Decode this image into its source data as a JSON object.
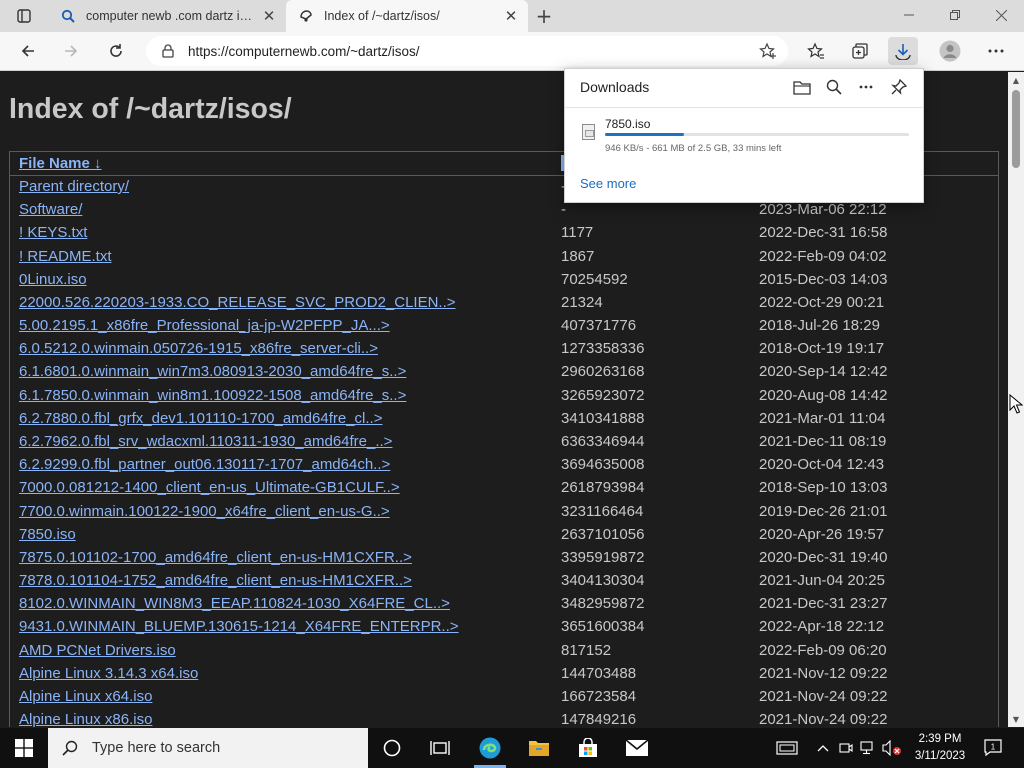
{
  "browser": {
    "tabs": [
      {
        "title": "computer newb .com dartz isos -",
        "active": false
      },
      {
        "title": "Index of /~dartz/isos/",
        "active": true
      }
    ],
    "url": "https://computernewb.com/~dartz/isos/"
  },
  "page": {
    "heading": "Index of /~dartz/isos/",
    "columns": {
      "name": "File Name",
      "sort_indicator": "↓"
    },
    "rows": [
      {
        "name": "Parent directory/",
        "size": "-",
        "date": ""
      },
      {
        "name": "Software/",
        "size": "-",
        "date": "2023-Mar-06 22:12"
      },
      {
        "name": "! KEYS.txt",
        "size": "1177",
        "date": "2022-Dec-31 16:58"
      },
      {
        "name": "! README.txt",
        "size": "1867",
        "date": "2022-Feb-09 04:02"
      },
      {
        "name": "0Linux.iso",
        "size": "70254592",
        "date": "2015-Dec-03 14:03"
      },
      {
        "name": "22000.526.220203-1933.CO_RELEASE_SVC_PROD2_CLIEN..>",
        "size": "21324",
        "date": "2022-Oct-29 00:21"
      },
      {
        "name": "5.00.2195.1_x86fre_Professional_ja-jp-W2PFPP_JA...>",
        "size": "407371776",
        "date": "2018-Jul-26 18:29"
      },
      {
        "name": "6.0.5212.0.winmain.050726-1915_x86fre_server-cli..>",
        "size": "1273358336",
        "date": "2018-Oct-19 19:17"
      },
      {
        "name": "6.1.6801.0.winmain_win7m3.080913-2030_amd64fre_s..>",
        "size": "2960263168",
        "date": "2020-Sep-14 12:42"
      },
      {
        "name": "6.1.7850.0.winmain_win8m1.100922-1508_amd64fre_s..>",
        "size": "3265923072",
        "date": "2020-Aug-08 14:42"
      },
      {
        "name": "6.2.7880.0.fbl_grfx_dev1.101110-1700_amd64fre_cl..>",
        "size": "3410341888",
        "date": "2021-Mar-01 11:04"
      },
      {
        "name": "6.2.7962.0.fbl_srv_wdacxml.110311-1930_amd64fre_..>",
        "size": "6363346944",
        "date": "2021-Dec-11 08:19"
      },
      {
        "name": "6.2.9299.0.fbl_partner_out06.130117-1707_amd64ch..>",
        "size": "3694635008",
        "date": "2020-Oct-04 12:43"
      },
      {
        "name": "7000.0.081212-1400_client_en-us_Ultimate-GB1CULF..>",
        "size": "2618793984",
        "date": "2018-Sep-10 13:03"
      },
      {
        "name": "7700.0.winmain.100122-1900_x64fre_client_en-us-G..>",
        "size": "3231166464",
        "date": "2019-Dec-26 21:01"
      },
      {
        "name": "7850.iso",
        "size": "2637101056",
        "date": "2020-Apr-26 19:57"
      },
      {
        "name": "7875.0.101102-1700_amd64fre_client_en-us-HM1CXFR..>",
        "size": "3395919872",
        "date": "2020-Dec-31 19:40"
      },
      {
        "name": "7878.0.101104-1752_amd64fre_client_en-us-HM1CXFR..>",
        "size": "3404130304",
        "date": "2021-Jun-04 20:25"
      },
      {
        "name": "8102.0.WINMAIN_WIN8M3_EEAP.110824-1030_X64FRE_CL..>",
        "size": "3482959872",
        "date": "2021-Dec-31 23:27"
      },
      {
        "name": "9431.0.WINMAIN_BLUEMP.130615-1214_X64FRE_ENTERPR..>",
        "size": "3651600384",
        "date": "2022-Apr-18 22:12"
      },
      {
        "name": "AMD PCNet Drivers.iso",
        "size": "817152",
        "date": "2022-Feb-09 06:20"
      },
      {
        "name": "Alpine Linux 3.14.3 x64.iso",
        "size": "144703488",
        "date": "2021-Nov-12 09:22"
      },
      {
        "name": "Alpine Linux x64.iso",
        "size": "166723584",
        "date": "2021-Nov-24 09:22"
      },
      {
        "name": "Alpine Linux x86.iso",
        "size": "147849216",
        "date": "2021-Nov-24 09:22"
      }
    ]
  },
  "downloads": {
    "title": "Downloads",
    "file_name": "7850.iso",
    "progress_fraction": 0.26,
    "status": "946 KB/s - 661 MB of 2.5 GB, 33 mins left",
    "see_more": "See more"
  },
  "taskbar": {
    "search_placeholder": "Type here to search",
    "time": "2:39 PM",
    "date": "3/11/2023",
    "notification_count": "1"
  },
  "colors": {
    "link": "#8ab4f8",
    "page_bg": "#1d1d1d",
    "progress": "#1a73c8"
  }
}
